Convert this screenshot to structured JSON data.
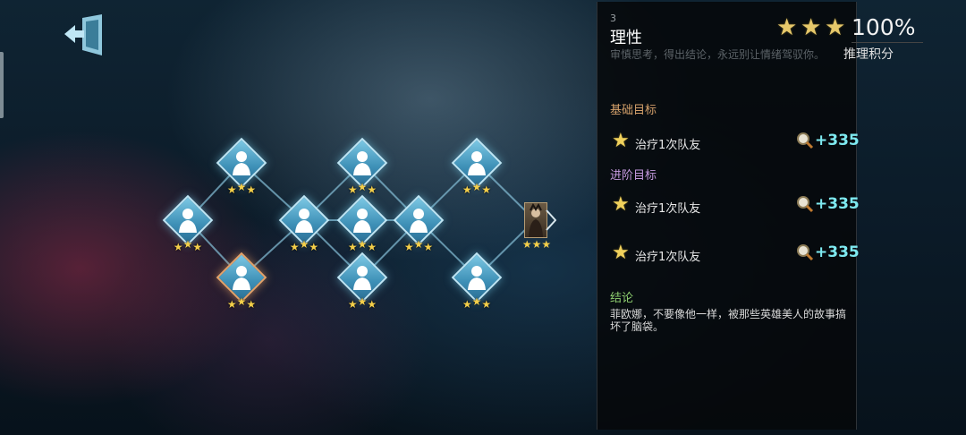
{
  "board": {
    "node_stars": 3,
    "final_stars": 3
  },
  "panel": {
    "number": "3",
    "title": "理性",
    "description": "审慎思考，得出结论，永远别让情绪驾驭你。",
    "rating_stars": 3,
    "rating_percent": "100%",
    "deduction_label": "推理积分",
    "basic_label": "基础目标",
    "advanced_label": "进阶目标",
    "basic_goals": [
      {
        "text": "治疗1次队友",
        "points": "+335",
        "stars": 1
      }
    ],
    "advanced_goals": [
      {
        "text": "治疗1次队友",
        "points": "+335",
        "stars": 1
      },
      {
        "text": "治疗1次队友",
        "points": "+335",
        "stars": 1
      }
    ],
    "conclusion_label": "结论",
    "conclusion_text": "菲欧娜，不要像他一样，被那些英雄美人的故事搞坏了脑袋。"
  },
  "colors": {
    "star": "#f4cf4a",
    "points": "#7ee9f0",
    "basic": "#d4a06a",
    "advanced": "#c69ae0",
    "conclusion": "#8fd070"
  }
}
